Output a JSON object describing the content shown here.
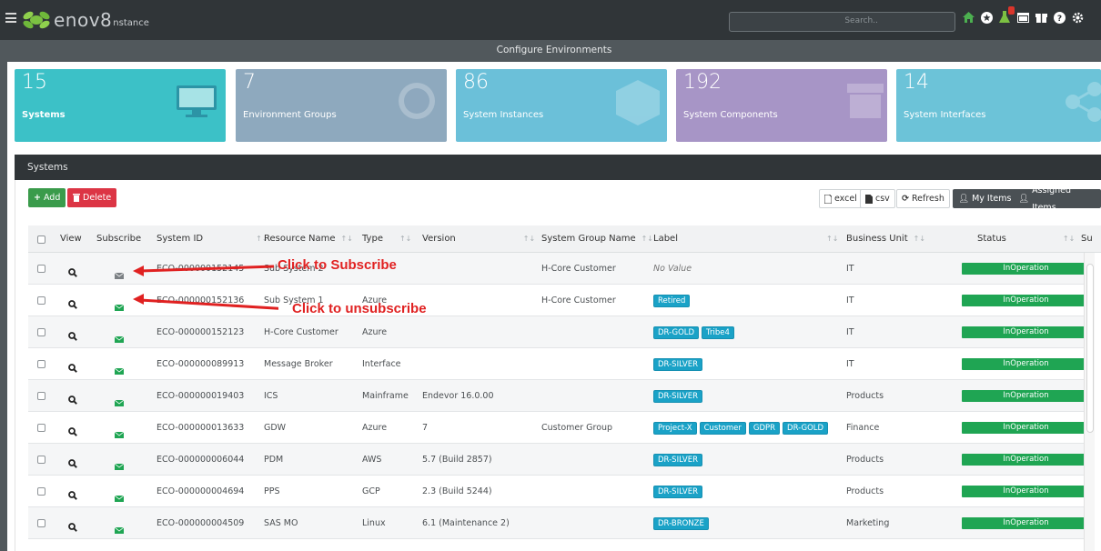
{
  "app": {
    "logo_text": "enov8",
    "logo_sub": "nstance",
    "search_placeholder": "Search..",
    "page_title": "Configure Environments"
  },
  "top_icons": [
    "home-icon",
    "star-icon",
    "flask-icon",
    "calendar-icon",
    "gift-icon",
    "help-icon",
    "gear-icon"
  ],
  "tiles": [
    {
      "count": "15",
      "label": "Systems",
      "color": "#3cc1c7",
      "icon": "monitor-icon"
    },
    {
      "count": "7",
      "label": "Environment Groups",
      "color": "#8ea9be",
      "icon": "globe-icon"
    },
    {
      "count": "86",
      "label": "System Instances",
      "color": "#6bc0d9",
      "icon": "cube-icon"
    },
    {
      "count": "192",
      "label": "System Components",
      "color": "#a795c6",
      "icon": "archive-icon"
    },
    {
      "count": "14",
      "label": "System Interfaces",
      "color": "#6cc3d8",
      "icon": "share-icon"
    }
  ],
  "panel": {
    "title": "Systems",
    "add_label": "Add",
    "delete_label": "Delete",
    "toolbar": {
      "excel": "excel",
      "csv": "csv",
      "refresh": "Refresh",
      "my_items": "My Items",
      "assigned_items": "Assigned Items"
    }
  },
  "columns": [
    "View",
    "Subscribe",
    "System ID",
    "Resource Name",
    "Type",
    "Version",
    "System Group Name",
    "Label",
    "Business Unit",
    "Status",
    "Su"
  ],
  "rows": [
    {
      "system_id": "ECO-000000152145",
      "resource": "Sub System 2",
      "type": "",
      "version": "",
      "group": "H-Core Customer",
      "labels": [],
      "label_text": "No Value",
      "unit": "IT",
      "status": "InOperation",
      "subscribed": false
    },
    {
      "system_id": "ECO-000000152136",
      "resource": "Sub System 1",
      "type": "Azure",
      "version": "",
      "group": "H-Core Customer",
      "labels": [
        "Retired"
      ],
      "label_text": "",
      "unit": "IT",
      "status": "InOperation",
      "subscribed": true
    },
    {
      "system_id": "ECO-000000152123",
      "resource": "H-Core Customer",
      "type": "Azure",
      "version": "",
      "group": "",
      "labels": [
        "DR-GOLD",
        "Tribe4"
      ],
      "label_text": "",
      "unit": "IT",
      "status": "InOperation",
      "subscribed": true
    },
    {
      "system_id": "ECO-000000089913",
      "resource": "Message Broker",
      "type": "Interface",
      "version": "",
      "group": "",
      "labels": [
        "DR-SILVER"
      ],
      "label_text": "",
      "unit": "IT",
      "status": "InOperation",
      "subscribed": true
    },
    {
      "system_id": "ECO-000000019403",
      "resource": "ICS",
      "type": "Mainframe",
      "version": "Endevor 16.0.00",
      "group": "",
      "labels": [
        "DR-SILVER"
      ],
      "label_text": "",
      "unit": "Products",
      "status": "InOperation",
      "subscribed": true
    },
    {
      "system_id": "ECO-000000013633",
      "resource": "GDW",
      "type": "Azure",
      "version": "7",
      "group": "Customer Group",
      "labels": [
        "Project-X",
        "Customer",
        "GDPR",
        "DR-GOLD"
      ],
      "label_text": "",
      "unit": "Finance",
      "status": "InOperation",
      "subscribed": true
    },
    {
      "system_id": "ECO-000000006044",
      "resource": "PDM",
      "type": "AWS",
      "version": "5.7 (Build 2857)",
      "group": "",
      "labels": [
        "DR-SILVER"
      ],
      "label_text": "",
      "unit": "Products",
      "status": "InOperation",
      "subscribed": true
    },
    {
      "system_id": "ECO-000000004694",
      "resource": "PPS",
      "type": "GCP",
      "version": "2.3 (Build 5244)",
      "group": "",
      "labels": [
        "DR-SILVER"
      ],
      "label_text": "",
      "unit": "Products",
      "status": "InOperation",
      "subscribed": true
    },
    {
      "system_id": "ECO-000000004509",
      "resource": "SAS MO",
      "type": "Linux",
      "version": "6.1 (Maintenance 2)",
      "group": "",
      "labels": [
        "DR-BRONZE"
      ],
      "label_text": "",
      "unit": "Marketing",
      "status": "InOperation",
      "subscribed": true
    }
  ],
  "annotations": {
    "subscribe": "Click to Subscribe",
    "unsubscribe": "Click to unsubscribe"
  },
  "colors": {
    "topbar": "#303538",
    "add_button": "#3a9b4b",
    "delete_button": "#dc3545",
    "status_green": "#1fa553",
    "tag_blue": "#1aa2c7",
    "annotation_red": "#e02121"
  }
}
